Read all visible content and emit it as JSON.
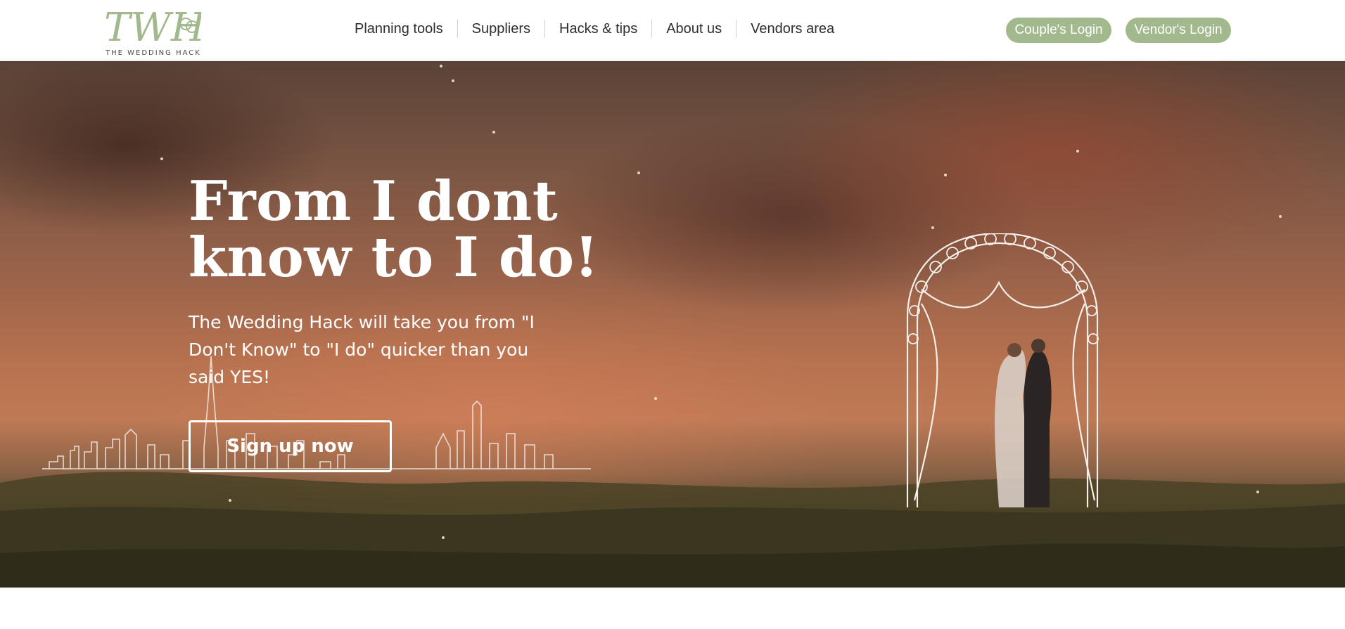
{
  "brand": {
    "monogram": "TWH",
    "name": "THE WEDDING HACK",
    "accent_color": "#a2b98e"
  },
  "nav": {
    "items": [
      {
        "label": "Planning tools"
      },
      {
        "label": "Suppliers"
      },
      {
        "label": "Hacks & tips"
      },
      {
        "label": "About us"
      },
      {
        "label": "Vendors area"
      }
    ]
  },
  "auth": {
    "couple_login_label": "Couple's Login",
    "vendor_login_label": "Vendor's Login"
  },
  "hero": {
    "title_line1": "From I dont",
    "title_line2": "know to I do!",
    "subtitle": "The Wedding Hack will take you from \"I Don't Know\" to \"I do\" quicker than you said YES!",
    "cta_label": "Sign up now",
    "image_description_icon": "couple-under-floral-arch-photo"
  }
}
